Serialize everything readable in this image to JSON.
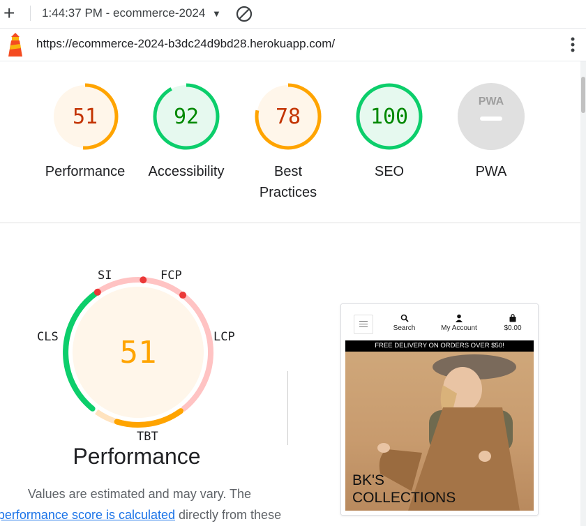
{
  "toolbar": {
    "report_select": "1:44:37 PM - ecommerce-2024",
    "new_report_icon": "plus-icon",
    "clear_icon": "block-icon"
  },
  "urlbar": {
    "url": "https://ecommerce-2024-b3dc24d9bd28.herokuapp.com/",
    "menu_icon": "kebab-icon",
    "logo_icon": "lighthouse-icon"
  },
  "scores": [
    {
      "label": "Performance",
      "score": "51",
      "fraction": 0.51,
      "status": "average"
    },
    {
      "label": "Accessibility",
      "score": "92",
      "fraction": 0.92,
      "status": "pass"
    },
    {
      "label": "Best Practices",
      "score": "78",
      "fraction": 0.78,
      "status": "average"
    },
    {
      "label": "SEO",
      "score": "100",
      "fraction": 1.0,
      "status": "pass"
    },
    {
      "label": "PWA",
      "score": "",
      "fraction": 0,
      "status": "na",
      "badge": "PWA"
    }
  ],
  "colors": {
    "pass": "#0cce6b",
    "pass_bg": "#e6f9ef",
    "pass_text": "#008800",
    "average": "#ffa400",
    "average_bg": "#fff6ea",
    "average_text": "#c33300",
    "fail": "#ff4e42",
    "na": "#e0e0e0"
  },
  "performance_detail": {
    "score": "51",
    "title": "Performance",
    "metrics": {
      "si": "SI",
      "fcp": "FCP",
      "lcp": "LCP",
      "tbt": "TBT",
      "cls": "CLS"
    },
    "note_prefix": "Values are estimated and may vary. The",
    "note_link": "performance score is calculated",
    "note_suffix": "directly from these"
  },
  "screenshot": {
    "nav": {
      "search": "Search",
      "account": "My Account",
      "cart": "$0.00"
    },
    "banner": "FREE DELIVERY ON ORDERS OVER $50!",
    "hero_line1": "BK'S",
    "hero_line2": "COLLECTIONS"
  }
}
